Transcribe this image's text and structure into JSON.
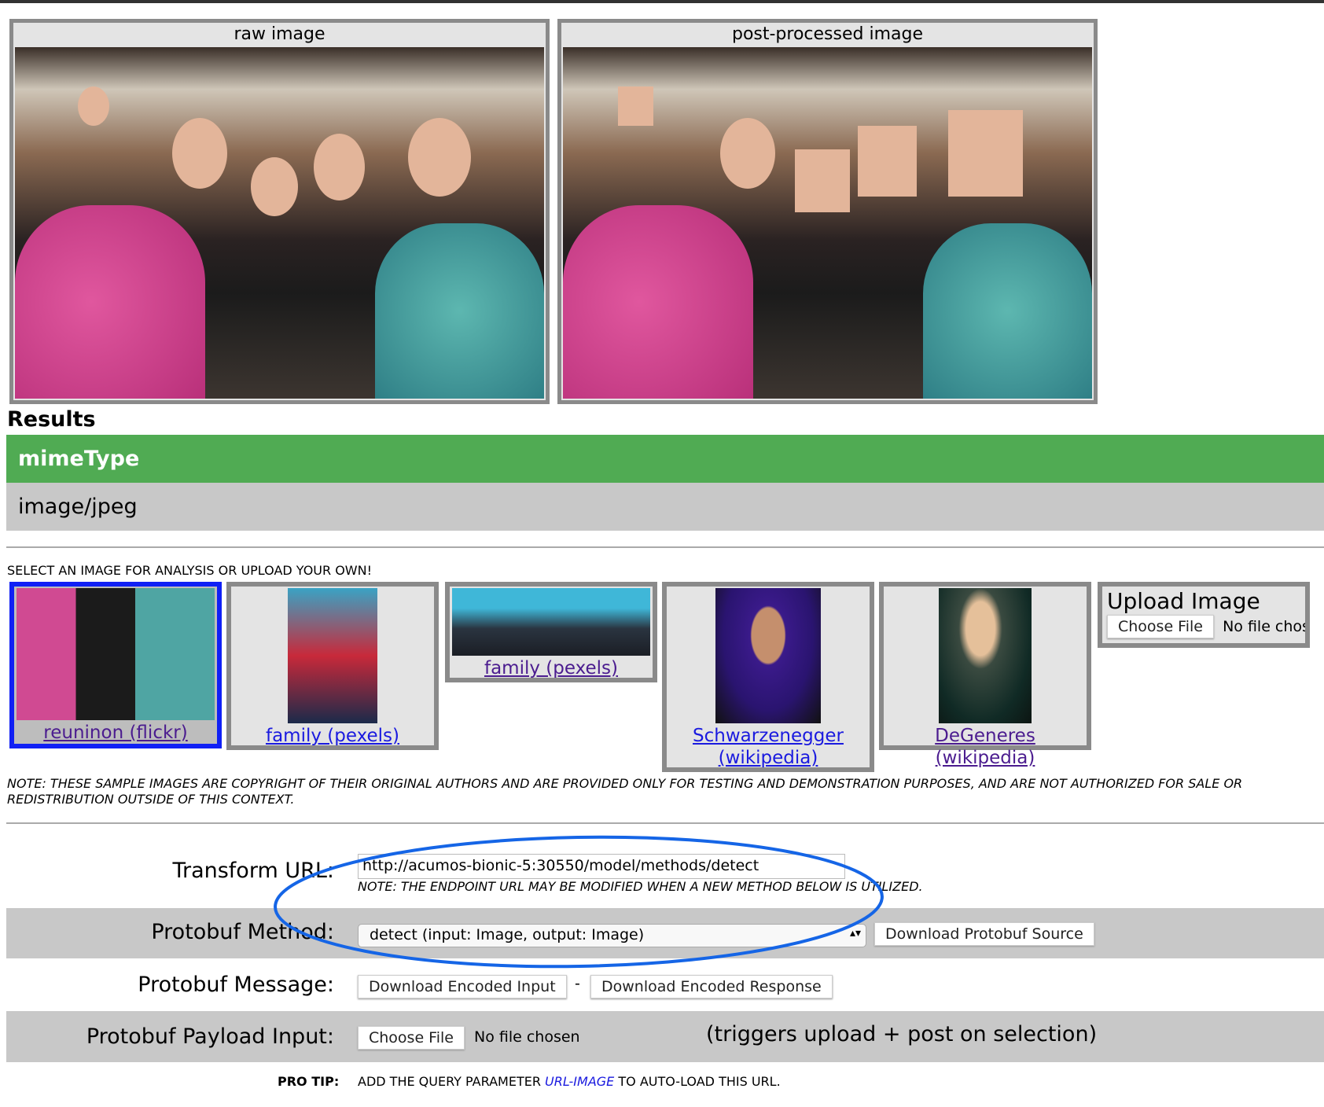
{
  "panels": {
    "raw": "raw image",
    "post": "post-processed image"
  },
  "results": {
    "heading": "Results",
    "field_name": "mimeType",
    "field_value": "image/jpeg"
  },
  "gallery": {
    "instruction": "SELECT AN IMAGE FOR ANALYSIS OR UPLOAD YOUR OWN!",
    "items": [
      {
        "label": "reuninon (flickr)",
        "selected": true
      },
      {
        "label": "family (pexels)"
      },
      {
        "label": "family (pexels)"
      },
      {
        "label": "Schwarzenegger (wikipedia)"
      },
      {
        "label": "DeGeneres (wikipedia)"
      }
    ],
    "upload": {
      "title": "Upload Image",
      "button": "Choose File",
      "status": "No file chosen"
    },
    "note": "NOTE: THESE SAMPLE IMAGES ARE COPYRIGHT OF THEIR ORIGINAL AUTHORS AND ARE PROVIDED ONLY FOR TESTING AND DEMONSTRATION PURPOSES, AND ARE NOT AUTHORIZED FOR SALE OR REDISTRIBUTION OUTSIDE OF THIS CONTEXT."
  },
  "form": {
    "transform_label": "Transform URL:",
    "transform_value": "http://acumos-bionic-5:30550/model/methods/detect",
    "transform_note": "NOTE: THE ENDPOINT URL MAY BE MODIFIED WHEN A NEW METHOD BELOW IS UTILIZED.",
    "method_label": "Protobuf Method:",
    "method_value": "detect (input: Image, output: Image)",
    "download_source": "Download Protobuf Source",
    "message_label": "Protobuf Message:",
    "download_input": "Download Encoded Input",
    "sep": "-",
    "download_response": "Download Encoded Response",
    "payload_label": "Protobuf Payload Input:",
    "payload_button": "Choose File",
    "payload_status": "No file chosen",
    "payload_hint": "(triggers upload + post on selection)",
    "protip_label": "PRO TIP:",
    "protip_pre": "ADD THE QUERY PARAMETER",
    "protip_link": "URL-IMAGE",
    "protip_post": "TO AUTO-LOAD THIS URL."
  },
  "colors": {
    "green": "#50ab53",
    "select": "#1020f5",
    "annotation": "#1565e6"
  }
}
